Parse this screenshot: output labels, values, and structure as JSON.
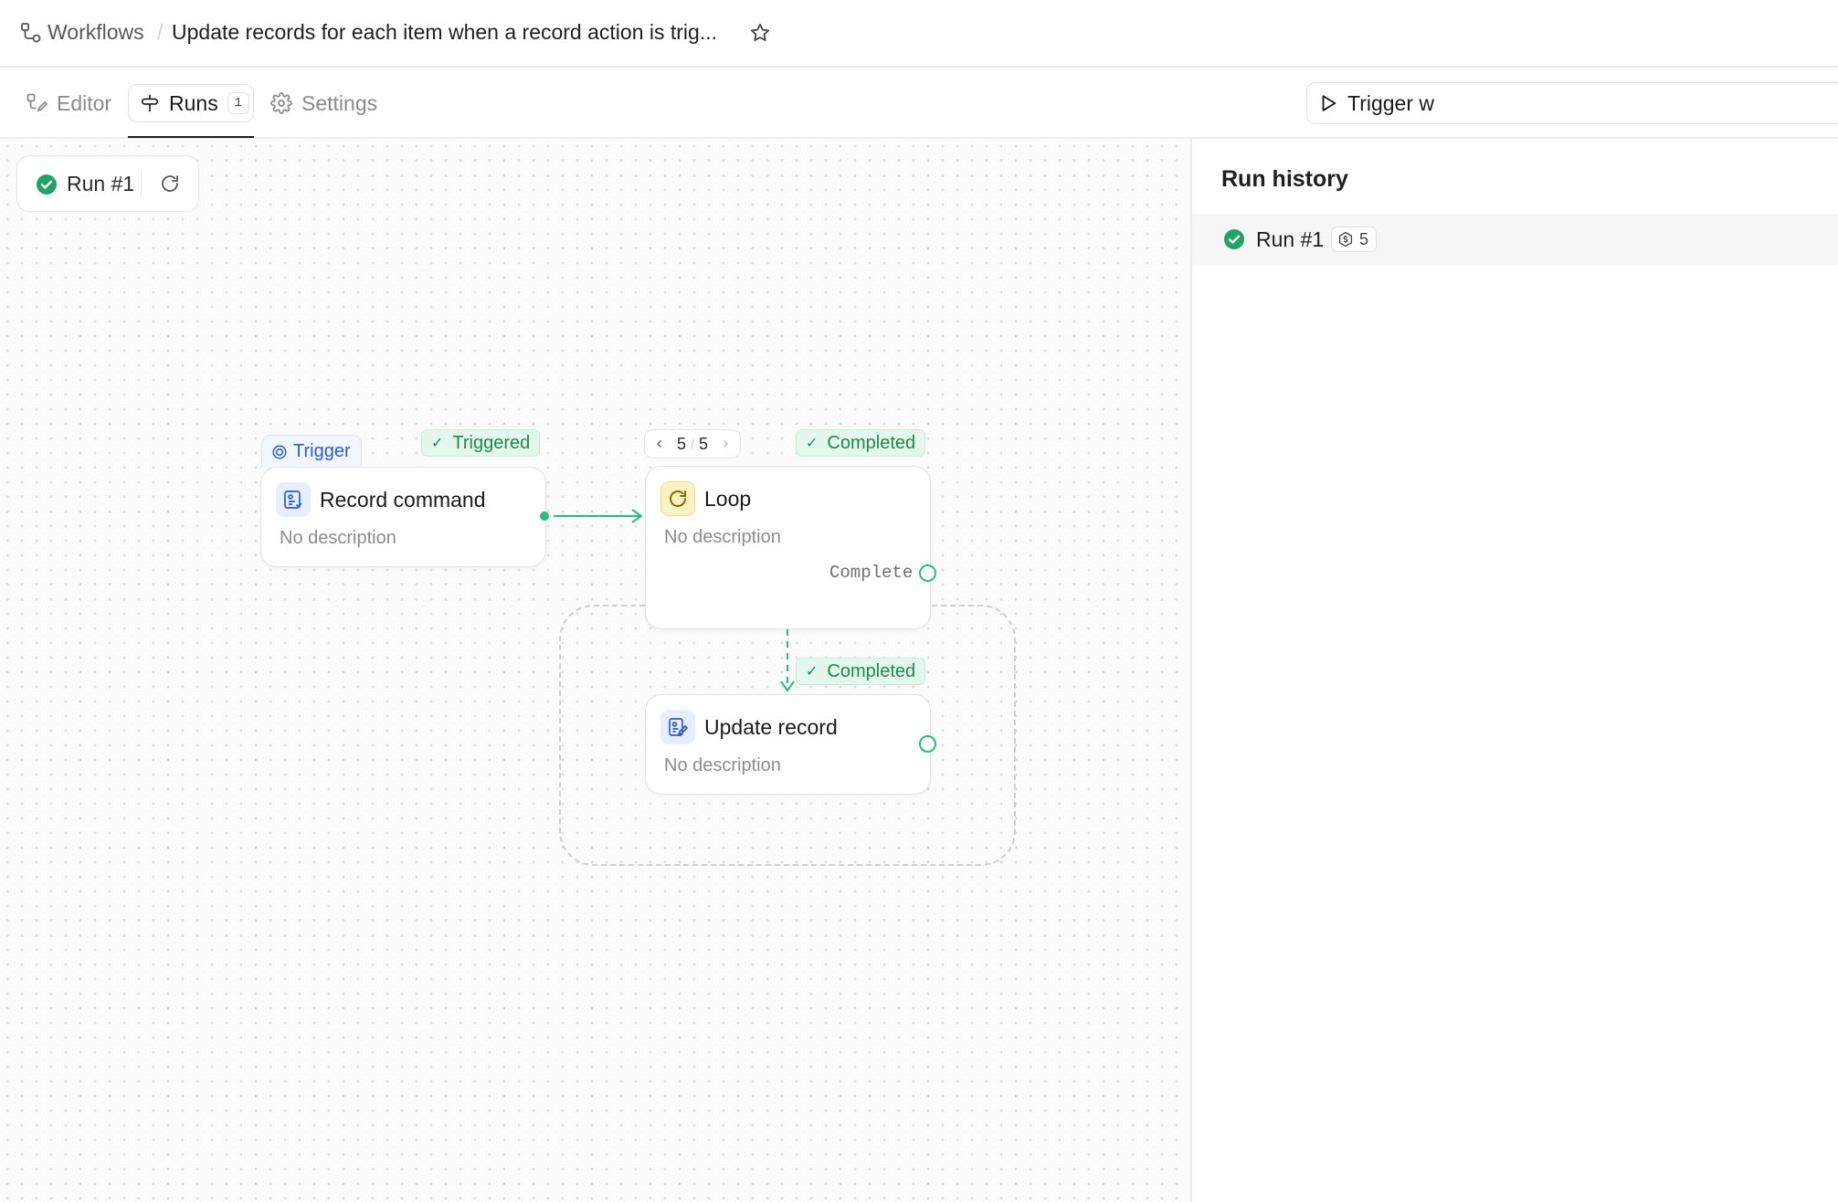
{
  "header": {
    "root": "Workflows",
    "separator": "/",
    "title": "Update records for each item when a record action is trig..."
  },
  "tabs": {
    "editor": "Editor",
    "runs": "Runs",
    "runs_count": "1",
    "settings": "Settings",
    "trigger_button": "Trigger w"
  },
  "canvas": {
    "run_chip_label": "Run #1",
    "trigger_tag": "Trigger",
    "nodes": {
      "record_command": {
        "title": "Record command",
        "description": "No description",
        "status": "Triggered"
      },
      "loop": {
        "title": "Loop",
        "description": "No description",
        "status": "Completed",
        "iteration_current": "5",
        "iteration_total": "5",
        "output_label": "Complete"
      },
      "update_record": {
        "title": "Update record",
        "description": "No description",
        "status": "Completed"
      }
    }
  },
  "panel": {
    "title": "Run history",
    "runs": [
      {
        "label": "Run #1",
        "cost": "5"
      }
    ]
  },
  "colors": {
    "success": "#22c07a",
    "success_text": "#1c8a4c",
    "trigger_blue": "#2a5bd7",
    "loop_yellow": "#fbf2c4"
  },
  "icons": {
    "workflow": "workflow-icon",
    "star": "star-icon",
    "editor": "editor-icon",
    "runs": "runs-icon",
    "settings": "gear-icon",
    "play": "play-icon",
    "check": "check-circle-icon",
    "refresh": "refresh-icon",
    "trigger": "target-icon",
    "record": "record-icon",
    "loop": "loop-icon",
    "cost": "coin-icon"
  }
}
